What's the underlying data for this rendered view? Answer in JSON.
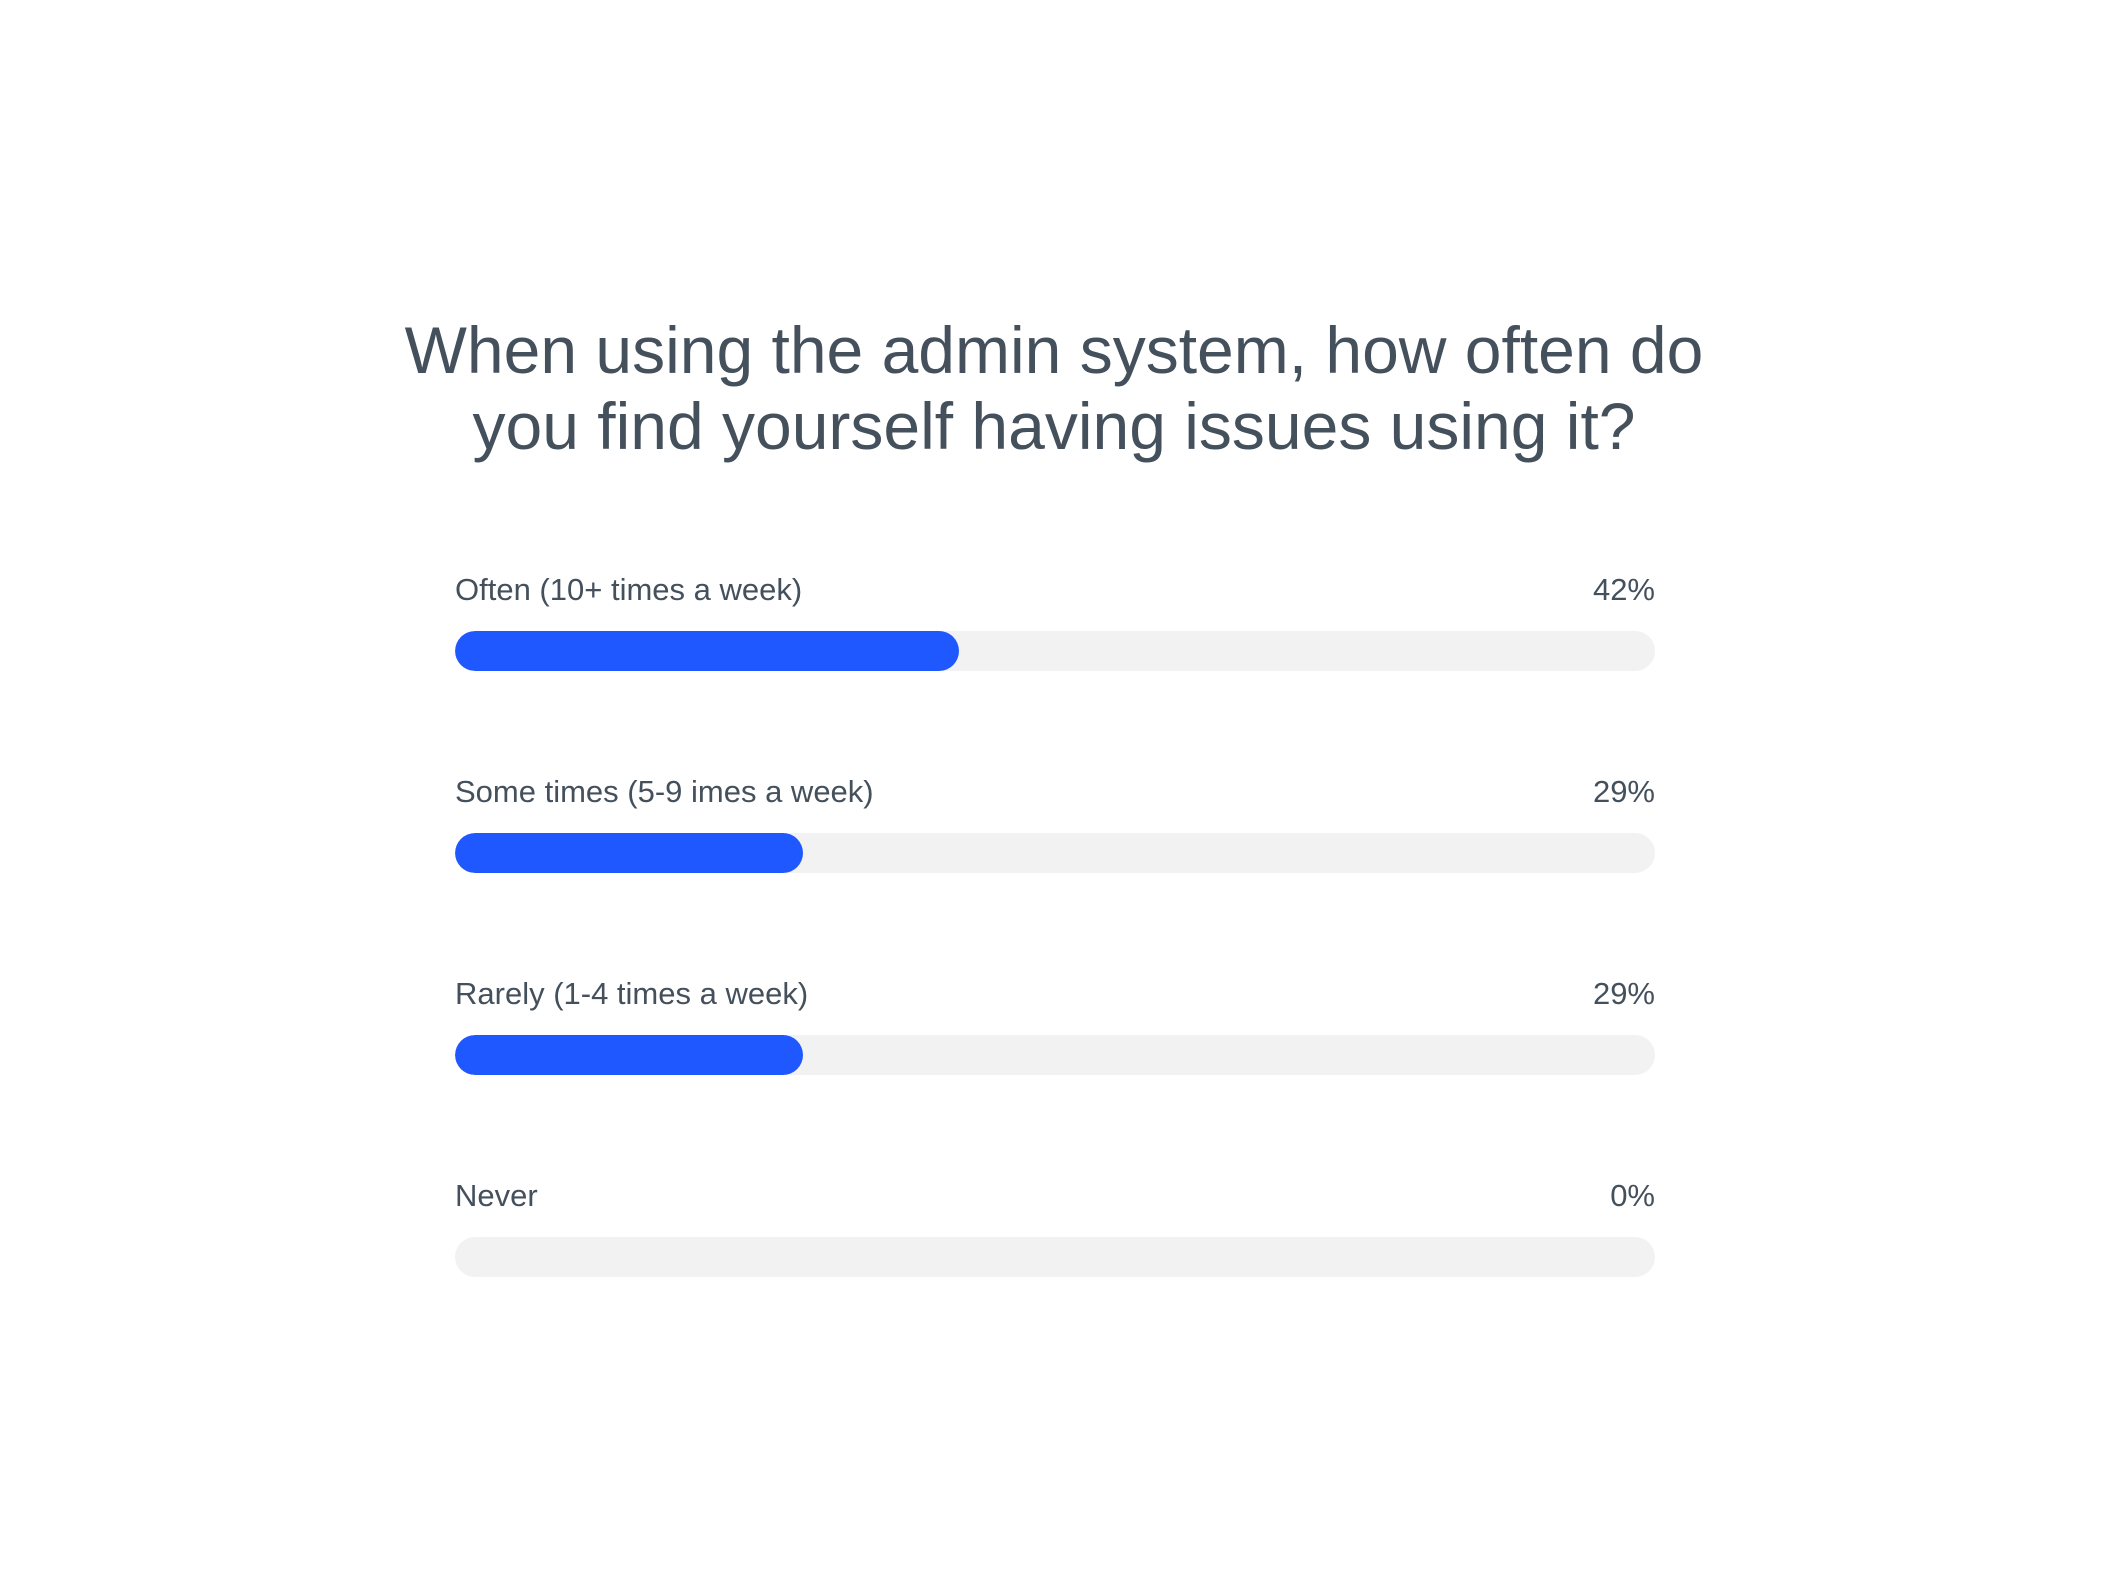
{
  "chart_data": {
    "type": "bar",
    "orientation": "horizontal",
    "title": "When using the admin system, how often do you find yourself having issues using it?",
    "categories": [
      "Often (10+ times a week)",
      "Some times (5-9 imes a week)",
      "Rarely (1-4 times a week)",
      "Never"
    ],
    "values": [
      42,
      29,
      29,
      0
    ],
    "value_labels": [
      "42%",
      "29%",
      "29%",
      "0%"
    ],
    "xlim": [
      0,
      100
    ],
    "unit": "%",
    "grid": false,
    "legend": "none",
    "colors": {
      "fill": "#1f58ff",
      "track": "#f2f2f2",
      "text": "#44505c"
    }
  }
}
